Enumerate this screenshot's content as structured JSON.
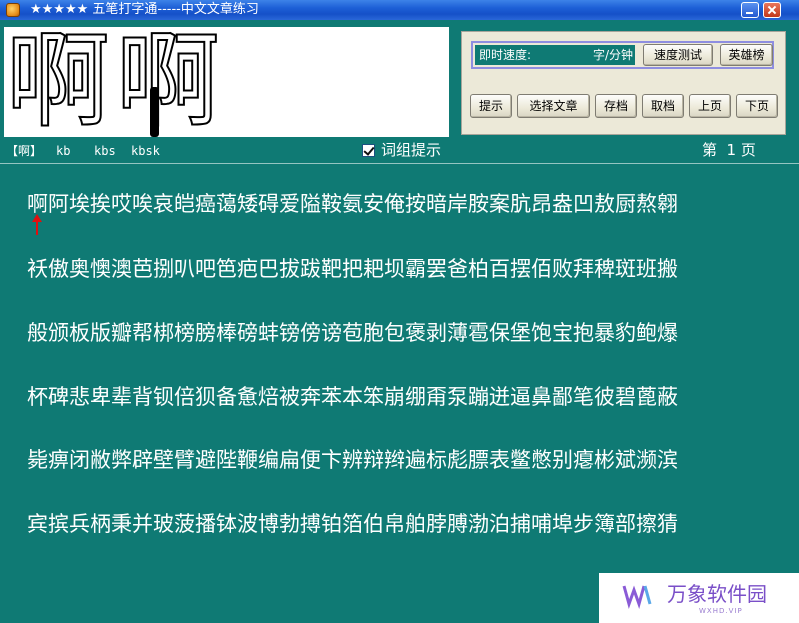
{
  "window": {
    "title": "★★★★★ 五笔打字通-----中文文章练习"
  },
  "char_panel": {
    "chars": [
      "啊",
      "啊"
    ]
  },
  "controls": {
    "speed_label": "即时速度:",
    "speed_unit": "字/分钟",
    "speed_test": "速度测试",
    "hero_list": "英雄榜",
    "hint": "提示",
    "choose_article": "选择文章",
    "save": "存档",
    "load": "取档",
    "prev_page": "上页",
    "next_page": "下页"
  },
  "hint_row": {
    "char": "【啊】",
    "code1": "kb",
    "code2": "kbs",
    "code3": "kbsk",
    "phrase_hint": "词组提示",
    "page": "第  1 页"
  },
  "article": {
    "lines": [
      "啊阿埃挨哎唉哀皑癌蔼矮碍爱隘鞍氨安俺按暗岸胺案肮昂盎凹敖厨熬翱",
      "袄傲奥懊澳芭捌叭吧笆疤巴拔跋靶把耙坝霸罢爸柏百摆佰败拜稗斑班搬",
      "般颁板版瓣帮梆榜膀棒磅蚌镑傍谤苞胞包褒剥薄雹保堡饱宝抱暴豹鲍爆",
      "杯碑悲卑辈背钡倍狈备惫焙被奔苯本笨崩绷甭泵蹦迸逼鼻鄙笔彼碧蓖蔽",
      "毙痹闭敝弊辟壁臂避陛鞭编扁便卞辨辩辫遍标彪膘表鳖憋别瘪彬斌濒滨",
      "宾摈兵柄秉并玻菠播钵波博勃搏铂箔伯帛舶脖膊渤泊捕哺埠步簿部擦猜"
    ]
  },
  "watermark": {
    "text": "万象软件园",
    "sub": "WXHD.VIP"
  }
}
